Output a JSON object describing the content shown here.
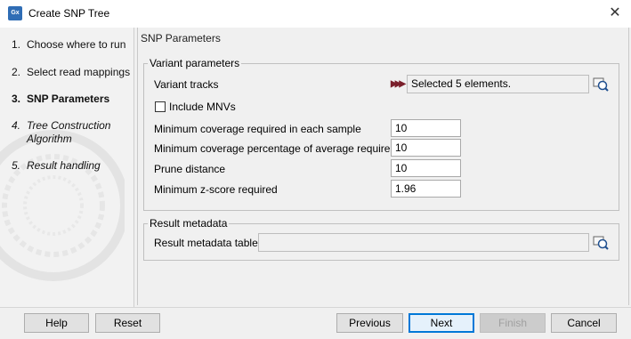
{
  "window": {
    "title": "Create SNP Tree",
    "app_icon_text": "Gx",
    "close_symbol": "✕"
  },
  "sidebar": {
    "steps": [
      {
        "num": "1.",
        "label": "Choose where to run",
        "state": "done"
      },
      {
        "num": "2.",
        "label": "Select read mappings",
        "state": "done"
      },
      {
        "num": "3.",
        "label": "SNP Parameters",
        "state": "current"
      },
      {
        "num": "4.",
        "label": "Tree Construction Algorithm",
        "state": "pending"
      },
      {
        "num": "5.",
        "label": "Result handling",
        "state": "pending"
      }
    ]
  },
  "main": {
    "section_title": "SNP Parameters",
    "variant_parameters": {
      "legend": "Variant parameters",
      "variant_tracks_label": "Variant tracks",
      "variant_tracks_value": "Selected 5 elements.",
      "include_mnvs_label": "Include MNVs",
      "include_mnvs_checked": false,
      "min_coverage_label": "Minimum coverage required in each sample",
      "min_coverage_value": "10",
      "min_coverage_pct_label": "Minimum coverage percentage of average required",
      "min_coverage_pct_value": "10",
      "prune_distance_label": "Prune distance",
      "prune_distance_value": "10",
      "min_zscore_label": "Minimum z-score required",
      "min_zscore_value": "1.96"
    },
    "result_metadata": {
      "legend": "Result metadata",
      "table_label": "Result metadata table",
      "table_value": ""
    }
  },
  "footer": {
    "help_label": "Help",
    "reset_label": "Reset",
    "previous_label": "Previous",
    "next_label": "Next",
    "finish_label": "Finish",
    "cancel_label": "Cancel"
  },
  "colors": {
    "accent": "#0078d7",
    "track_icon": "#7a1f2b"
  }
}
